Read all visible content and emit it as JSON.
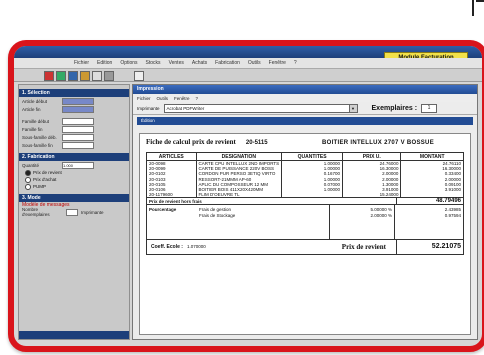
{
  "app": {
    "module_label": "Module Facturation"
  },
  "menu": [
    "Fichier",
    "Edition",
    "Options",
    "Stocks",
    "Ventes",
    "Achats",
    "Fabrication",
    "Outils",
    "Fenêtre",
    "?"
  ],
  "colors": {
    "frame_red": "#d9141b",
    "module_yellow": "#f2e14a",
    "title_blue": "#224c94"
  },
  "left_panel": {
    "section1": "1. Sélection",
    "rows1": [
      {
        "label": "Article début"
      },
      {
        "label": "Article fin"
      }
    ],
    "rows2": [
      {
        "label": "Famille début"
      },
      {
        "label": "Famille fin"
      },
      {
        "label": "Sous-famille déb."
      },
      {
        "label": "Sous-famille fin"
      }
    ],
    "section2": "2. Fabrication",
    "qty_label": "Quantité",
    "qty_value": "1.000",
    "options": [
      "Prix de revient",
      "Prix d'achat",
      "PUMP"
    ],
    "section3": "3. Mode",
    "model_label": "Modèle de messages",
    "bottom_labels": [
      "Nombre d'exemplaires",
      "Imprimante"
    ]
  },
  "window": {
    "title": "Impression",
    "menu": [
      "Fichier",
      "Outils",
      "Fenêtre",
      "?"
    ],
    "printer_label": "Imprimante",
    "printer_value": "Acrobat PDFWriter",
    "copies_label": "Exemplaires :",
    "copies_value": "1",
    "subtitle": "Édition"
  },
  "doc": {
    "heading": "Fiche de calcul prix de revient",
    "ref": "20-5115",
    "product": "BOITIER INTELLUX 2707 V BOSSUE",
    "columns": [
      "ARTICLES",
      "DESIGNATION",
      "QUANTITES",
      "PRIX U.",
      "MONTANT"
    ],
    "rows": [
      [
        "20-0098",
        "CARTE CPU INTELLUX 2ND IMPORTS",
        "1.00000",
        "24.76000",
        "24.76110"
      ],
      [
        "20-0099",
        "CARTE DE PUISSANCE 220V BOSS",
        "1.00000",
        "16.30000",
        "16.30000"
      ],
      [
        "20-0102",
        "CORDON PUR PERSO 3ETIQ VIRTO",
        "0.16700",
        "2.00000",
        "0.33400"
      ],
      [
        "20-0103",
        "RESSORT-21MMM AP-60",
        "1.00000",
        "2.00000",
        "2.00000"
      ],
      [
        "20-0105",
        "APLIC DU COMPOSSEUR 12 MM",
        "0.07000",
        "1.30000",
        "0.09100"
      ],
      [
        "20-0106",
        "BOITIER BOIS 411X20X420MM",
        "1.00000",
        "3.91000",
        "3.91000"
      ],
      [
        "20-1179600",
        "FLIM D'OEUVRE TL",
        "",
        "15.24000",
        ""
      ]
    ],
    "subtotal_label": "Prix de revient hors frais",
    "subtotal_value": "48.79496",
    "fees_label": "Pourcentage",
    "fees": [
      {
        "label": "Frais de gestion",
        "pct": "5.00000 %",
        "amount": "2.43985"
      },
      {
        "label": "Frais de Stockage",
        "pct": "2.00000 %",
        "amount": "0.97594"
      }
    ],
    "coef_label": "Coeff. Ecole :",
    "coef_value": "1.070000",
    "total_label": "Prix de revient",
    "total_value": "52.21075"
  }
}
